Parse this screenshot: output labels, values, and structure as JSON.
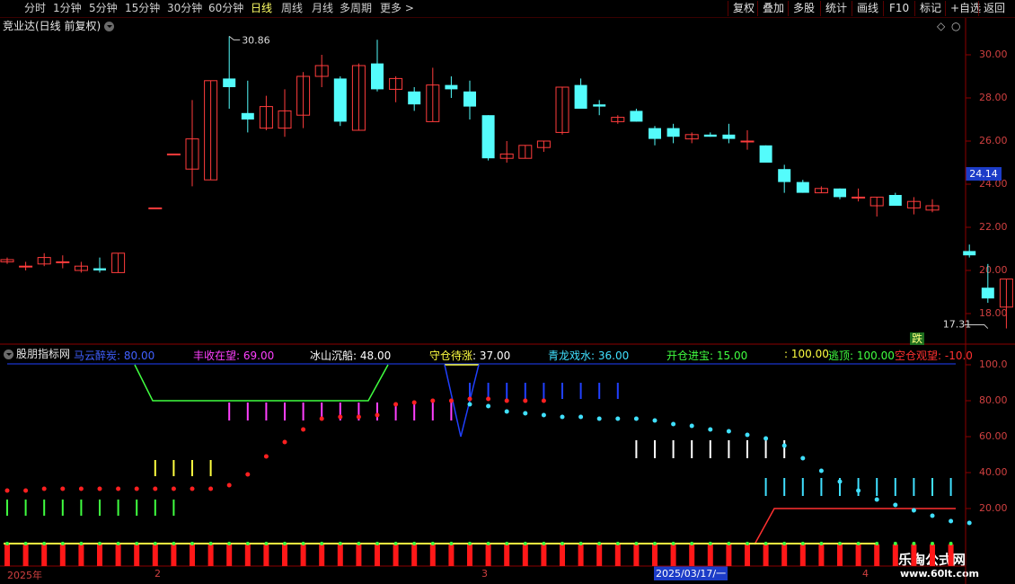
{
  "toolbar": {
    "periods": [
      {
        "label": "分时",
        "active": false
      },
      {
        "label": "1分钟",
        "active": false
      },
      {
        "label": "5分钟",
        "active": false
      },
      {
        "label": "15分钟",
        "active": false
      },
      {
        "label": "30分钟",
        "active": false
      },
      {
        "label": "60分钟",
        "active": false
      },
      {
        "label": "日线",
        "active": true
      },
      {
        "label": "周线",
        "active": false
      },
      {
        "label": "月线",
        "active": false
      },
      {
        "label": "多周期",
        "active": false
      },
      {
        "label": "更多",
        "active": false
      }
    ],
    "actions": [
      "复权",
      "叠加",
      "多股",
      "统计",
      "画线",
      "F10",
      "标记",
      "+自选",
      "返回"
    ]
  },
  "main_panel": {
    "title": "竞业达(日线 前复权)",
    "y_ticks": [
      "30.00",
      "28.00",
      "26.00",
      "24.00",
      "22.00",
      "20.00",
      "18.00"
    ],
    "current_price": "24.14",
    "high_label": "30.86",
    "low_label": "17.31",
    "sell_signal": "跌"
  },
  "indicator_panel": {
    "title": "股朋指标网",
    "series": [
      {
        "name": "马云醉炭",
        "value": "80.00",
        "color": "#4060ff"
      },
      {
        "name": "丰收在望",
        "value": "69.00",
        "color": "#ff40ff"
      },
      {
        "name": "冰山沉船",
        "value": "48.00",
        "color": "#ffffff"
      },
      {
        "name": "守仓待涨",
        "value": "37.00",
        "color": "#ffff40"
      },
      {
        "name": "青龙戏水",
        "value": "36.00",
        "color": "#40e0ff"
      },
      {
        "name": "开仓进宝",
        "value": "15.00",
        "color": "#40ff40"
      },
      {
        "name": "",
        "value": "100.00",
        "color": "#ffff40"
      },
      {
        "name": "逃顶",
        "value": "100.00",
        "color": "#40ff40"
      },
      {
        "name": "空仓观望",
        "value": "-10.0",
        "color": "#ff3030"
      }
    ],
    "y_ticks": [
      "100.0",
      "80.00",
      "60.00",
      "40.00",
      "20.00"
    ]
  },
  "bottom_axis": {
    "labels": [
      "2025年",
      "2",
      "3",
      "2025/03/17/一",
      "4"
    ]
  },
  "watermark": {
    "brand": "乐淘公式网",
    "url": "www.60lt.com"
  },
  "chart_data": {
    "type": "candlestick",
    "ylim": [
      17,
      31.5
    ],
    "candles": [
      {
        "o": 20.4,
        "c": 20.5,
        "h": 20.6,
        "l": 20.3
      },
      {
        "o": 20.2,
        "c": 20.2,
        "h": 20.4,
        "l": 20.0
      },
      {
        "o": 20.3,
        "c": 20.6,
        "h": 20.8,
        "l": 20.2
      },
      {
        "o": 20.4,
        "c": 20.4,
        "h": 20.7,
        "l": 20.1
      },
      {
        "o": 20.0,
        "c": 20.2,
        "h": 20.4,
        "l": 19.9
      },
      {
        "o": 20.1,
        "c": 20.0,
        "h": 20.6,
        "l": 19.9
      },
      {
        "o": 19.9,
        "c": 20.8,
        "h": 20.8,
        "l": 19.9
      },
      null,
      {
        "o": 22.9,
        "c": 22.9,
        "h": 22.9,
        "l": 22.9
      },
      {
        "o": 25.4,
        "c": 25.4,
        "h": 25.4,
        "l": 25.4
      },
      {
        "o": 24.7,
        "c": 26.1,
        "h": 27.9,
        "l": 23.9
      },
      {
        "o": 24.2,
        "c": 28.8,
        "h": 28.8,
        "l": 24.2
      },
      {
        "o": 28.9,
        "c": 28.5,
        "h": 30.86,
        "l": 27.5
      },
      {
        "o": 27.3,
        "c": 27.0,
        "h": 28.8,
        "l": 26.4
      },
      {
        "o": 26.6,
        "c": 27.6,
        "h": 28.1,
        "l": 26.5
      },
      {
        "o": 26.6,
        "c": 27.4,
        "h": 28.4,
        "l": 26.2
      },
      {
        "o": 27.2,
        "c": 29.0,
        "h": 29.2,
        "l": 26.6
      },
      {
        "o": 29.0,
        "c": 29.5,
        "h": 30.0,
        "l": 28.5
      },
      {
        "o": 28.9,
        "c": 26.9,
        "h": 29.0,
        "l": 26.7
      },
      {
        "o": 26.5,
        "c": 29.5,
        "h": 29.6,
        "l": 26.5
      },
      {
        "o": 29.6,
        "c": 28.4,
        "h": 30.7,
        "l": 28.3
      },
      {
        "o": 28.4,
        "c": 28.9,
        "h": 29.0,
        "l": 27.8
      },
      {
        "o": 28.3,
        "c": 27.7,
        "h": 28.5,
        "l": 27.4
      },
      {
        "o": 26.9,
        "c": 28.6,
        "h": 29.4,
        "l": 26.9
      },
      {
        "o": 28.6,
        "c": 28.4,
        "h": 29.0,
        "l": 28.0
      },
      {
        "o": 28.3,
        "c": 27.6,
        "h": 28.8,
        "l": 27.0
      },
      {
        "o": 27.2,
        "c": 25.2,
        "h": 27.2,
        "l": 25.1
      },
      {
        "o": 25.2,
        "c": 25.4,
        "h": 26.0,
        "l": 25.0
      },
      {
        "o": 25.2,
        "c": 25.8,
        "h": 25.8,
        "l": 25.2
      },
      {
        "o": 25.7,
        "c": 26.0,
        "h": 26.0,
        "l": 25.5
      },
      {
        "o": 26.4,
        "c": 28.5,
        "h": 28.5,
        "l": 26.3
      },
      {
        "o": 28.6,
        "c": 27.5,
        "h": 28.9,
        "l": 27.5
      },
      {
        "o": 27.7,
        "c": 27.6,
        "h": 27.9,
        "l": 27.2
      },
      {
        "o": 26.9,
        "c": 27.1,
        "h": 27.2,
        "l": 26.8
      },
      {
        "o": 27.4,
        "c": 26.9,
        "h": 27.5,
        "l": 26.9
      },
      {
        "o": 26.6,
        "c": 26.1,
        "h": 26.7,
        "l": 25.8
      },
      {
        "o": 26.6,
        "c": 26.2,
        "h": 26.8,
        "l": 25.9
      },
      {
        "o": 26.1,
        "c": 26.3,
        "h": 26.4,
        "l": 25.9
      },
      {
        "o": 26.3,
        "c": 26.2,
        "h": 26.4,
        "l": 26.2
      },
      {
        "o": 26.3,
        "c": 26.1,
        "h": 26.8,
        "l": 25.9
      },
      {
        "o": 26.0,
        "c": 26.0,
        "h": 26.5,
        "l": 25.6
      },
      {
        "o": 25.8,
        "c": 25.0,
        "h": 25.8,
        "l": 25.0
      },
      {
        "o": 24.7,
        "c": 24.1,
        "h": 24.9,
        "l": 23.6
      },
      {
        "o": 24.1,
        "c": 23.6,
        "h": 24.2,
        "l": 23.6
      },
      {
        "o": 23.6,
        "c": 23.8,
        "h": 23.9,
        "l": 23.6
      },
      {
        "o": 23.8,
        "c": 23.4,
        "h": 23.8,
        "l": 23.3
      },
      {
        "o": 23.4,
        "c": 23.4,
        "h": 23.8,
        "l": 23.2
      },
      {
        "o": 23.0,
        "c": 23.4,
        "h": 23.4,
        "l": 22.5
      },
      {
        "o": 23.5,
        "c": 23.0,
        "h": 23.6,
        "l": 23.0
      },
      {
        "o": 22.9,
        "c": 23.2,
        "h": 23.4,
        "l": 22.6
      },
      {
        "o": 22.8,
        "c": 23.0,
        "h": 23.3,
        "l": 22.7
      },
      null,
      {
        "o": 20.9,
        "c": 20.7,
        "h": 21.2,
        "l": 20.6
      },
      {
        "o": 19.2,
        "c": 18.7,
        "h": 20.3,
        "l": 18.5
      },
      {
        "o": 18.3,
        "c": 19.6,
        "h": 19.6,
        "l": 17.31
      }
    ],
    "indicator": {
      "ylim": [
        -10,
        100
      ],
      "red_dots": [
        30,
        30,
        31,
        31,
        31,
        31,
        31,
        31,
        31,
        31,
        31,
        31,
        33,
        39,
        49,
        57,
        64,
        70,
        71,
        71,
        72,
        78,
        79,
        80,
        80,
        81,
        81,
        80,
        80,
        80
      ],
      "cyan_dots": [
        78,
        77,
        74,
        73,
        72,
        71,
        71,
        70,
        70,
        70,
        69,
        67,
        66,
        64,
        63,
        61,
        59,
        55,
        48,
        41,
        35,
        30,
        25,
        22,
        19,
        16,
        13,
        12
      ],
      "green_line": [
        [
          150,
          100
        ],
        [
          170,
          80
        ],
        [
          410,
          80
        ],
        [
          432,
          100
        ]
      ],
      "blue_v": [
        [
          495,
          100
        ],
        [
          513,
          60
        ],
        [
          533,
          100
        ]
      ],
      "red_line": [
        [
          840,
          0
        ],
        [
          862,
          20
        ],
        [
          1064,
          20
        ]
      ]
    }
  }
}
